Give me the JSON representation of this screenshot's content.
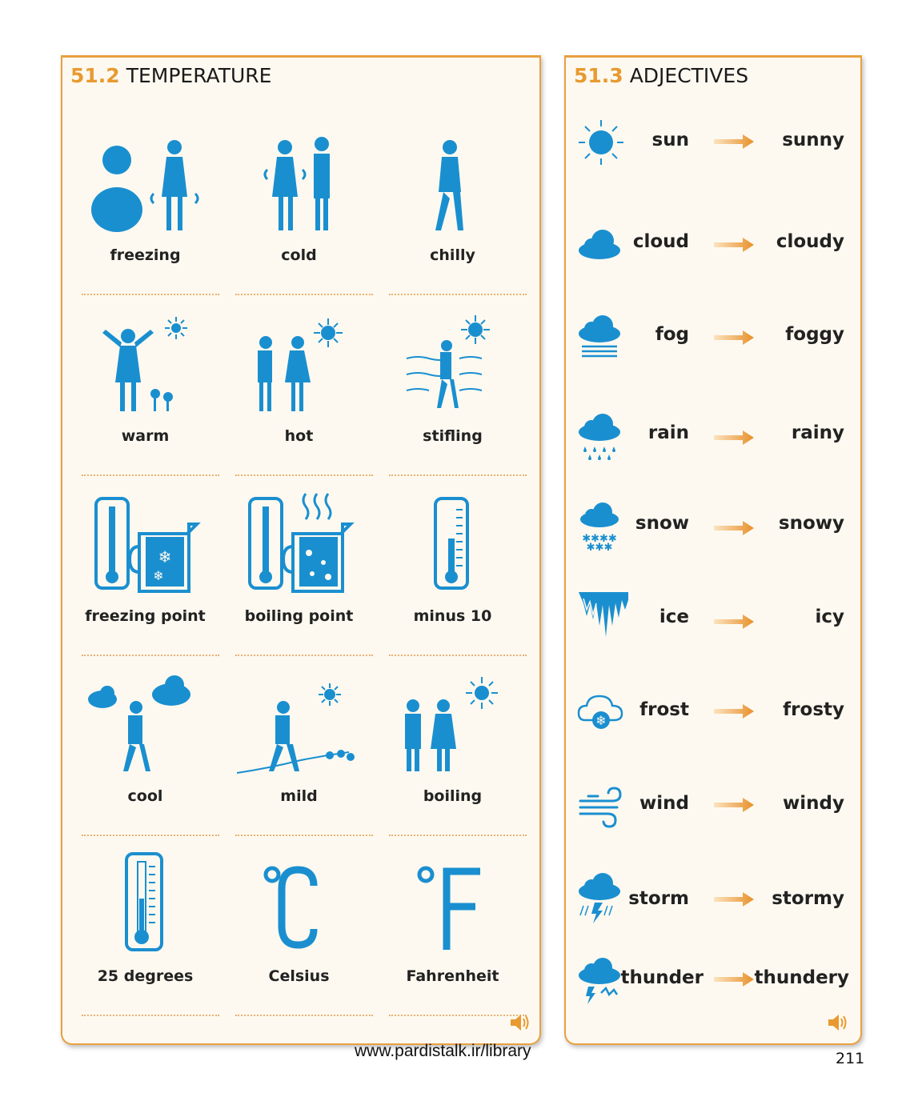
{
  "temperature": {
    "number": "51.2",
    "title": "TEMPERATURE",
    "items": [
      {
        "label": "freezing",
        "icon": "freezing-icon"
      },
      {
        "label": "cold",
        "icon": "cold-icon"
      },
      {
        "label": "chilly",
        "icon": "chilly-icon"
      },
      {
        "label": "warm",
        "icon": "warm-icon"
      },
      {
        "label": "hot",
        "icon": "hot-icon"
      },
      {
        "label": "stifling",
        "icon": "stifling-icon"
      },
      {
        "label": "freezing point",
        "icon": "freezing-point-icon"
      },
      {
        "label": "boiling point",
        "icon": "boiling-point-icon"
      },
      {
        "label": "minus 10",
        "icon": "minus-10-icon"
      },
      {
        "label": "cool",
        "icon": "cool-icon"
      },
      {
        "label": "mild",
        "icon": "mild-icon"
      },
      {
        "label": "boiling",
        "icon": "boiling-icon"
      },
      {
        "label": "25 degrees",
        "icon": "thermometer-icon"
      },
      {
        "label": "Celsius",
        "icon": "celsius-icon"
      },
      {
        "label": "Fahrenheit",
        "icon": "fahrenheit-icon"
      }
    ]
  },
  "adjectives": {
    "number": "51.3",
    "title": "ADJECTIVES",
    "items": [
      {
        "noun": "sun",
        "adjective": "sunny",
        "icon": "sun-icon"
      },
      {
        "noun": "cloud",
        "adjective": "cloudy",
        "icon": "cloud-icon"
      },
      {
        "noun": "fog",
        "adjective": "foggy",
        "icon": "fog-icon"
      },
      {
        "noun": "rain",
        "adjective": "rainy",
        "icon": "rain-icon"
      },
      {
        "noun": "snow",
        "adjective": "snowy",
        "icon": "snow-icon"
      },
      {
        "noun": "ice",
        "adjective": "icy",
        "icon": "ice-icon"
      },
      {
        "noun": "frost",
        "adjective": "frosty",
        "icon": "frost-icon"
      },
      {
        "noun": "wind",
        "adjective": "windy",
        "icon": "wind-icon"
      },
      {
        "noun": "storm",
        "adjective": "stormy",
        "icon": "storm-icon"
      },
      {
        "noun": "thunder",
        "adjective": "thundery",
        "icon": "thunder-icon"
      }
    ]
  },
  "footer": {
    "url": "www.pardistalk.ir/library",
    "page": "211"
  },
  "colors": {
    "accent": "#e89a30",
    "icon_blue": "#1a8fd0",
    "panel_bg": "#fdf9f0"
  }
}
